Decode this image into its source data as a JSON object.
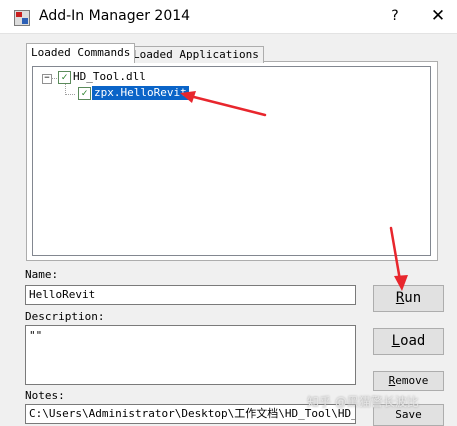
{
  "window": {
    "title": "Add-In Manager 2014",
    "help_label": "?",
    "close_label": "✕"
  },
  "tabs": [
    {
      "label": "Loaded Commands",
      "selected": true
    },
    {
      "label": "Loaded Applications",
      "selected": false
    }
  ],
  "tree": {
    "expander": "−",
    "root": {
      "label": "HD_Tool.dll",
      "checked": true
    },
    "child": {
      "label": "zpx.HelloRevit",
      "checked": true,
      "selected": true
    }
  },
  "form": {
    "name_label": "Name:",
    "name_value": "HelloRevit",
    "description_label": "Description:",
    "description_value": "\"\"",
    "notes_label": "Notes:",
    "notes_value": "C:\\Users\\Administrator\\Desktop\\工作文档\\HD_Tool\\HD_Too"
  },
  "buttons": {
    "run": {
      "mnemonic": "R",
      "rest": "un"
    },
    "load": {
      "mnemonic": "L",
      "rest": "oad"
    },
    "remove": {
      "mnemonic": "R",
      "rest": "emove"
    },
    "save": {
      "label": "Save"
    }
  },
  "annotation": {
    "arrow_color": "#e8262d"
  },
  "watermark": "知乎 @黑猫警长波比"
}
